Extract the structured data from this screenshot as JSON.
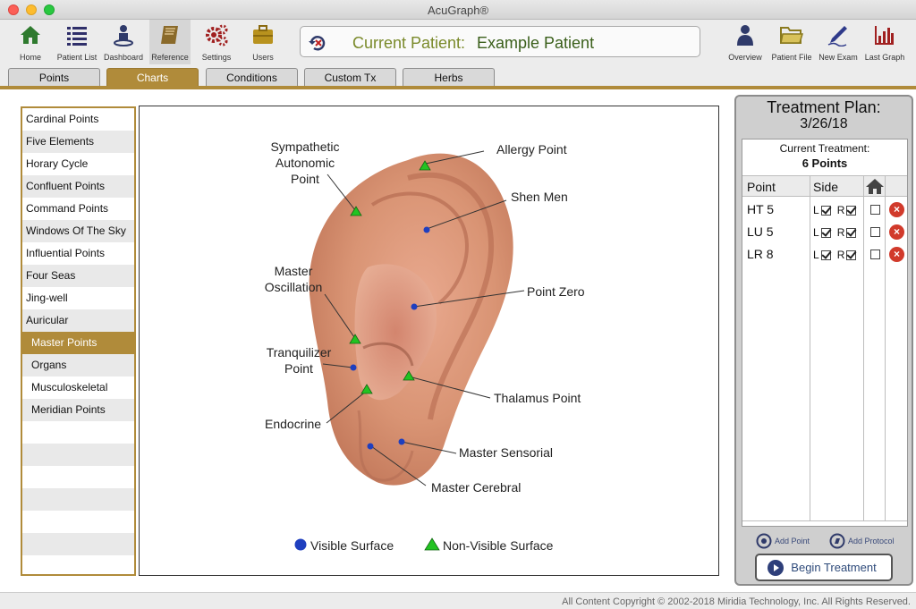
{
  "window": {
    "title": "AcuGraph®"
  },
  "toolbar": {
    "home": "Home",
    "patient_list": "Patient List",
    "dashboard": "Dashboard",
    "reference": "Reference",
    "settings": "Settings",
    "users": "Users",
    "overview": "Overview",
    "patient_file": "Patient File",
    "new_exam": "New Exam",
    "last_graph": "Last Graph"
  },
  "patient": {
    "label": "Current Patient:",
    "name": "Example Patient"
  },
  "tabs": [
    "Points",
    "Charts",
    "Conditions",
    "Custom Tx",
    "Herbs"
  ],
  "active_tab": "Charts",
  "chart_list": [
    "Cardinal Points",
    "Five Elements",
    "Horary Cycle",
    "Confluent Points",
    "Command Points",
    "Windows Of The Sky",
    "Influential Points",
    "Four Seas",
    "Jing-well",
    "Auricular",
    "Master Points",
    "Organs",
    "Musculoskeletal",
    "Meridian Points"
  ],
  "active_chart": "Master Points",
  "ear_chart": {
    "labels": {
      "sympathetic": "Sympathetic\nAutonomic\nPoint",
      "allergy": "Allergy Point",
      "shen_men": "Shen Men",
      "master_osc": "Master\nOscillation",
      "point_zero": "Point Zero",
      "tranquilizer": "Tranquilizer\nPoint",
      "thalamus": "Thalamus Point",
      "endocrine": "Endocrine",
      "master_sensorial": "Master Sensorial",
      "master_cerebral": "Master Cerebral"
    },
    "legend": {
      "visible": "Visible Surface",
      "non_visible": "Non-Visible Surface"
    },
    "colors": {
      "visible": "#1f3fbf",
      "non_visible": "#22c322"
    }
  },
  "treatment_plan": {
    "title": "Treatment Plan:",
    "date": "3/26/18",
    "current_label": "Current Treatment:",
    "count": "6 Points",
    "col_point": "Point",
    "col_side": "Side",
    "rows": [
      {
        "point": "HT 5",
        "left": true,
        "right": true,
        "home": false
      },
      {
        "point": "LU 5",
        "left": true,
        "right": true,
        "home": false
      },
      {
        "point": "LR 8",
        "left": true,
        "right": true,
        "home": false
      }
    ],
    "side_l": "L",
    "side_r": "R",
    "add_point": "Add Point",
    "add_protocol": "Add Protocol",
    "begin": "Begin Treatment"
  },
  "footer": "All Content Copyright © 2002-2018 Miridia Technology, Inc.  All Rights Reserved."
}
